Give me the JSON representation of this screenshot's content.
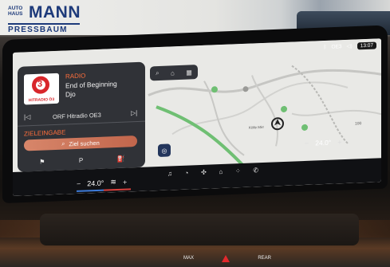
{
  "logo": {
    "small": [
      "AUTO",
      "HAUS"
    ],
    "big": "MANN",
    "sub": "PRESSBAUM"
  },
  "status": {
    "radio": "OE3",
    "time": "13:07"
  },
  "media": {
    "source": "RADIO",
    "title": "End of Beginning",
    "artist": "Djo",
    "station": "ORF Hitradio OE3",
    "logo_number": "3",
    "logo_caption": "HITRADIO Ö3",
    "prev_icon": "skip-back-icon",
    "next_icon": "skip-forward-icon"
  },
  "navigation": {
    "label": "ZIELEINGABE",
    "placeholder": "Ziel suchen",
    "quick_items": [
      "flag-icon",
      "P",
      "fuel-icon"
    ]
  },
  "map": {
    "town": "Kölle Mirr",
    "scale": "100"
  },
  "climate": {
    "left_temp": "24.0°",
    "right_temp": "24.0°",
    "minus": "−",
    "plus": "+"
  },
  "bottom_bar": [
    "music-icon",
    "navigation-icon",
    "fan-icon",
    "home-icon",
    "apps-icon",
    "phone-icon"
  ],
  "console": {
    "max_label": "MAX",
    "rear_label": "REAR"
  },
  "colors": {
    "accent": "#ff6f3c",
    "road_green": "#6fbf73",
    "hazard": "#e2292c"
  }
}
